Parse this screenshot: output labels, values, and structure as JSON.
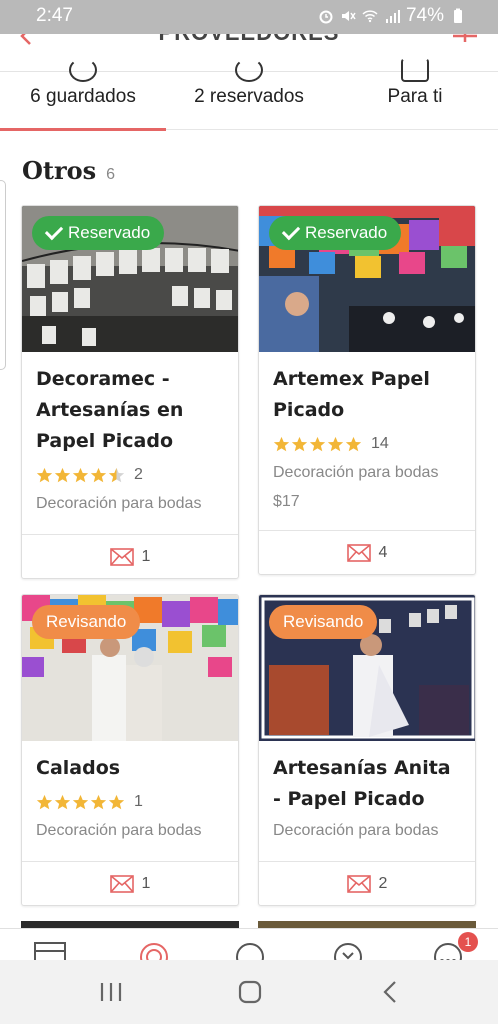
{
  "status_bar": {
    "time": "2:47",
    "battery": "74%"
  },
  "header": {
    "title": "PROVEEDORES"
  },
  "tabs": [
    {
      "label": "6 guardados",
      "active": true
    },
    {
      "label": "2 reservados",
      "active": false
    },
    {
      "label": "Para ti",
      "active": false
    }
  ],
  "section": {
    "title": "Otros",
    "count": "6"
  },
  "cards": [
    {
      "name": "Decoramec - Artesanías en Papel Picado",
      "badge": "Reservado",
      "badge_color": "#3aa94b",
      "stars": 4.5,
      "reviews": "2",
      "category": "Decoración para bodas",
      "price": "",
      "messages": "1"
    },
    {
      "name": "Artemex Papel Picado",
      "badge": "Reservado",
      "badge_color": "#3aa94b",
      "stars": 5,
      "reviews": "14",
      "category": "Decoración para bodas",
      "price": "$17",
      "messages": "4"
    },
    {
      "name": "Calados",
      "badge": "Revisando",
      "badge_color": "#f08c48",
      "stars": 5,
      "reviews": "1",
      "category": "Decoración para bodas",
      "price": "",
      "messages": "1"
    },
    {
      "name": "Artesanías Anita - Papel Picado",
      "badge": "Revisando",
      "badge_color": "#f08c48",
      "stars": 0,
      "reviews": "",
      "category": "Decoración para bodas",
      "price": "",
      "messages": "2"
    }
  ],
  "bottom_nav": {
    "badge": "1",
    "items": [
      "catalog-icon",
      "planner-icon",
      "rings-icon",
      "community-icon",
      "more-icon"
    ]
  },
  "colors": {
    "accent": "#e56665",
    "star": "#f2b637",
    "reserved": "#3aa94b",
    "reviewing": "#f08c48"
  }
}
